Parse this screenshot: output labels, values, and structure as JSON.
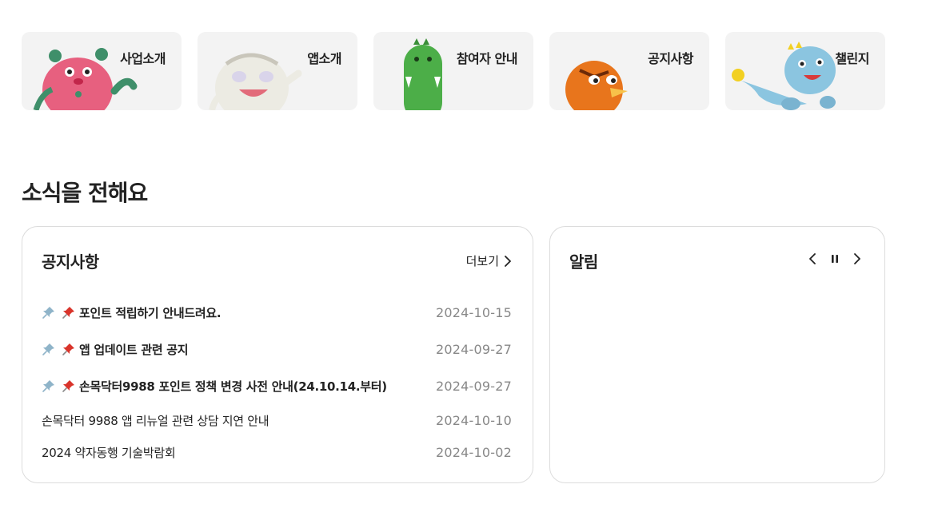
{
  "menu_cards": [
    {
      "label": "사업소개",
      "mascot": "pink-monster-mascot"
    },
    {
      "label": "앱소개",
      "mascot": "white-tiger-mascot"
    },
    {
      "label": "참여자 안내",
      "mascot": "green-dinosaur-mascot"
    },
    {
      "label": "공지사항",
      "mascot": "orange-bird-mascot"
    },
    {
      "label": "챌린지",
      "mascot": "blue-dinosaur-mascot"
    }
  ],
  "news": {
    "section_title": "소식을 전해요",
    "notice_panel": {
      "title": "공지사항",
      "more_label": "더보기",
      "items": [
        {
          "title": "포인트 적립하기 안내드려요.",
          "date": "2024-10-15",
          "pinned": true
        },
        {
          "title": "앱 업데이트 관련 공지",
          "date": "2024-09-27",
          "pinned": true
        },
        {
          "title": "손목닥터9988 포인트 정책 변경 사전 안내(24.10.14.부터)",
          "date": "2024-09-27",
          "pinned": true
        },
        {
          "title": "손목닥터 9988 앱 리뉴얼 관련 상담 지연 안내",
          "date": "2024-10-10",
          "pinned": false
        },
        {
          "title": "2024 약자동행 기술박람회",
          "date": "2024-10-02",
          "pinned": false
        }
      ]
    },
    "alert_panel": {
      "title": "알림",
      "controls": [
        "chevron-left-icon",
        "pause-icon",
        "chevron-right-icon"
      ]
    }
  },
  "colors": {
    "card_bg": "#f3f3f3",
    "panel_border": "#dcdcdc",
    "date_text": "#888888",
    "pin_blue": "#8fb4c9",
    "pin_red": "#d9342b"
  }
}
